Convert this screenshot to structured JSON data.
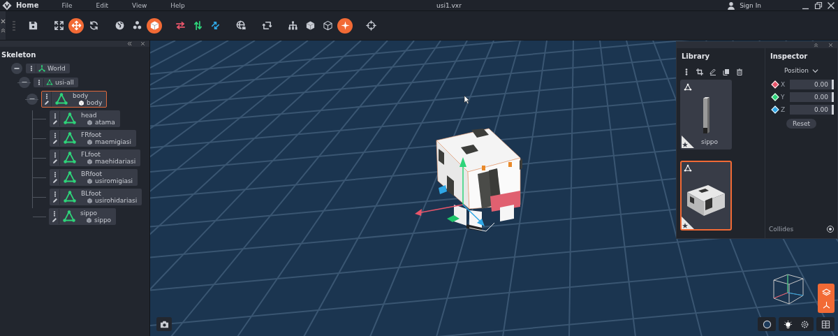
{
  "window": {
    "app_menu": "Home",
    "menus": [
      "File",
      "Edit",
      "View",
      "Help"
    ],
    "title": "usi1.vxr",
    "account": "Sign In"
  },
  "toolbar": {
    "groups": [
      [
        {
          "kind": "save",
          "active": false
        }
      ],
      [
        {
          "kind": "fit",
          "active": false
        },
        {
          "kind": "move",
          "active": true
        },
        {
          "kind": "rotate",
          "active": false
        }
      ],
      [
        {
          "kind": "globe",
          "active": false
        },
        {
          "kind": "nodes",
          "active": false
        },
        {
          "kind": "cube",
          "active": true
        }
      ],
      [
        {
          "kind": "swap_h",
          "active": false
        },
        {
          "kind": "swap_v",
          "active": false
        },
        {
          "kind": "swap_d",
          "active": false
        }
      ],
      [
        {
          "kind": "globe_cam",
          "active": false
        }
      ],
      [
        {
          "kind": "rotate_sq",
          "active": false
        }
      ],
      [
        {
          "kind": "hierarchy",
          "active": false
        },
        {
          "kind": "cube_solid",
          "active": false
        },
        {
          "kind": "cube_outline",
          "active": false
        },
        {
          "kind": "star",
          "active": true
        }
      ],
      [
        {
          "kind": "crosshair",
          "active": false
        }
      ]
    ]
  },
  "skeleton": {
    "title": "Skeleton",
    "tree": [
      {
        "kind": "world",
        "label": "World",
        "expanded": true,
        "selected": false,
        "children": [
          {
            "kind": "group",
            "label": "usi-all",
            "expanded": true,
            "selected": false,
            "children": [
              {
                "kind": "bone",
                "label": "body",
                "mesh": "body",
                "expanded": true,
                "selected": true,
                "children": [
                  {
                    "kind": "bone",
                    "label": "head",
                    "mesh": "atama",
                    "selected": false
                  },
                  {
                    "kind": "bone",
                    "label": "FRfoot",
                    "mesh": "maemigiasi",
                    "selected": false
                  },
                  {
                    "kind": "bone",
                    "label": "FLfoot",
                    "mesh": "maehidariasi",
                    "selected": false
                  },
                  {
                    "kind": "bone",
                    "label": "BRfoot",
                    "mesh": "usiromigiasi",
                    "selected": false
                  },
                  {
                    "kind": "bone",
                    "label": "BLfoot",
                    "mesh": "usirohidariasi",
                    "selected": false
                  },
                  {
                    "kind": "bone",
                    "label": "sippo",
                    "mesh": "sippo",
                    "selected": false
                  }
                ]
              }
            ]
          }
        ]
      }
    ]
  },
  "library": {
    "title": "Library",
    "items": [
      {
        "kind": "tail",
        "label": "sippo",
        "selected": false
      },
      {
        "kind": "body",
        "selected": true
      }
    ]
  },
  "inspector": {
    "title": "Inspector",
    "section": "Position",
    "axes": [
      {
        "label": "X",
        "value": "0.00",
        "color": "#e8556a"
      },
      {
        "label": "Y",
        "value": "0.00",
        "color": "#2ed47a"
      },
      {
        "label": "Z",
        "value": "0.00",
        "color": "#2fa7e6"
      }
    ],
    "reset": "Reset",
    "collides": {
      "label": "Collides",
      "checked": true
    }
  }
}
